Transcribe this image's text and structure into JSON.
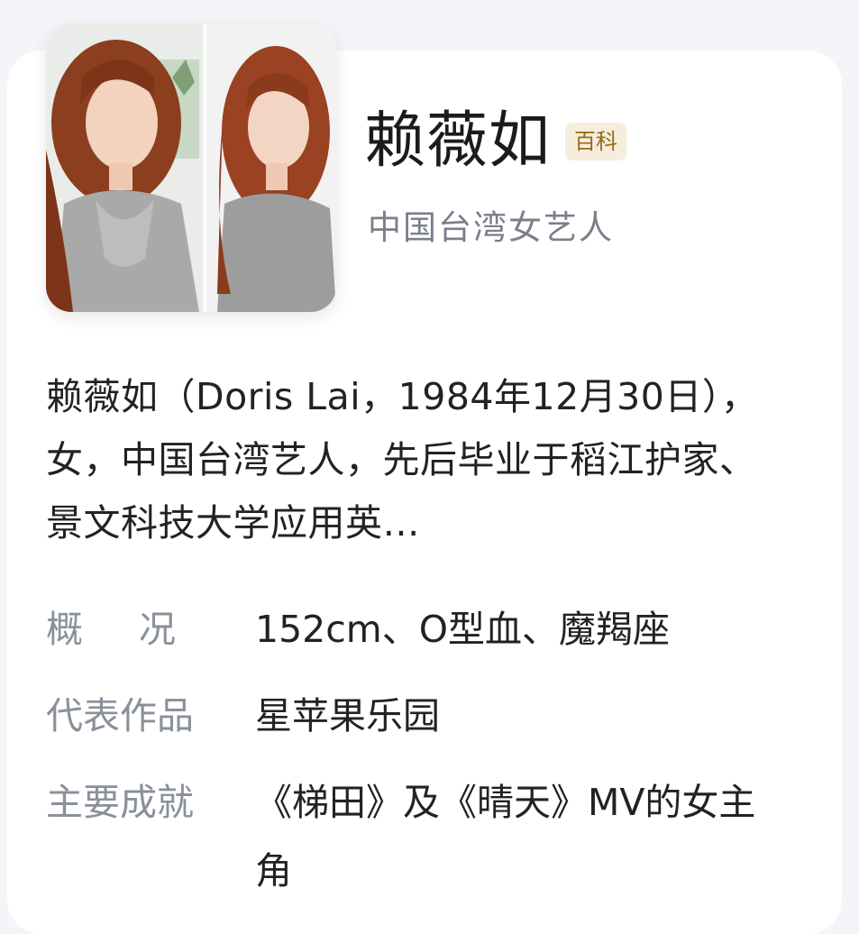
{
  "entry": {
    "name": "赖薇如",
    "badge": "百科",
    "subtitle": "中国台湾女艺人",
    "intro": "赖薇如（Doris Lai，1984年12月30日），女，中国台湾艺人，先后毕业于稻江护家、景文科技大学应用英…"
  },
  "facts": [
    {
      "label": "概况",
      "value": "152cm、O型血、魔羯座"
    },
    {
      "label": "代表作品",
      "value": "星苹果乐园"
    },
    {
      "label": "主要成就",
      "value": "《梯田》及《晴天》MV的女主角"
    }
  ],
  "colors": {
    "background": "#f3f5f8",
    "card": "#ffffff",
    "badge_text": "#9a6a16",
    "badge_bg": "#f6eddc",
    "label": "#8a909a"
  }
}
